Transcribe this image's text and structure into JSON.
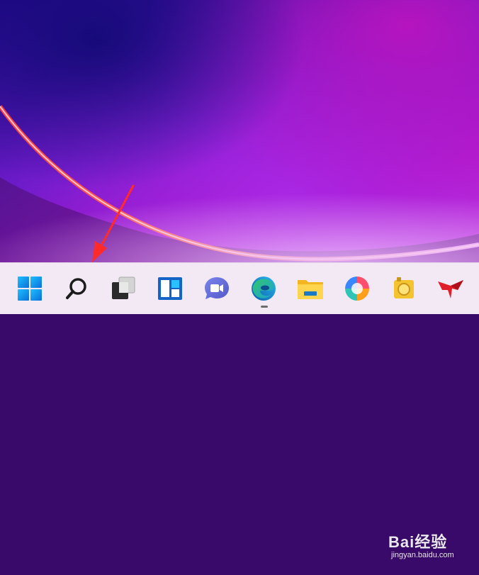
{
  "desktop": {
    "wallpaper": "windows-11-bloom-purple"
  },
  "annotation": {
    "type": "red-arrow",
    "color": "#ff2a2a",
    "points_to": "search-button"
  },
  "taskbar": {
    "items": [
      {
        "id": "start",
        "icon": "windows-start-icon"
      },
      {
        "id": "search",
        "icon": "search-icon"
      },
      {
        "id": "task-view",
        "icon": "task-view-icon"
      },
      {
        "id": "widgets",
        "icon": "widgets-icon"
      },
      {
        "id": "chat",
        "icon": "teams-chat-icon"
      },
      {
        "id": "edge",
        "icon": "edge-browser-icon",
        "active": true
      },
      {
        "id": "explorer",
        "icon": "folder-icon"
      },
      {
        "id": "photos",
        "icon": "colorful-circle-icon"
      },
      {
        "id": "app9",
        "icon": "app-icon"
      },
      {
        "id": "app10",
        "icon": "red-logo-icon"
      }
    ]
  },
  "watermark": {
    "logo": "Bai经验",
    "url": "jingyan.baidu.com"
  }
}
